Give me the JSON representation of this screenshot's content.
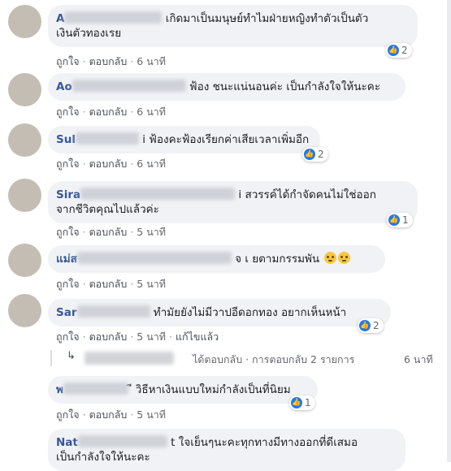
{
  "actions": {
    "like": "ถูกใจ",
    "reply": "ตอบกลับ",
    "edited": "แก้ไขแล้ว"
  },
  "comments": [
    {
      "name": "A",
      "text1": "เกิดมาเป็นมนุษย์ทำไมฝ่ายหญิงทำตัวเป็นตัว",
      "text2": "เงินตัวทองเรย",
      "time": "6 นาที",
      "reactions": "2"
    },
    {
      "name": "Ao",
      "text1": "ฟ้อง ชนะแน่นอนค่ะ เป็นกำลังใจให้นะคะ",
      "time": "6 นาที"
    },
    {
      "name": "Sul",
      "text1": "i ฟ้องคะฟ้องเรียกค่าเสียเวลาเพิ่มอีก",
      "time": "6 นาที",
      "reactions": "2"
    },
    {
      "name": "Sira",
      "text1": "i สวรรค์ได้กำจัดคนไม่ใช่ออก",
      "text2": "จากชีวิตคุณไปแล้วค่ะ",
      "time": "5 นาที",
      "reactions": "1"
    },
    {
      "name": "แม่ส",
      "text1": "จ เ ยตามกรรมพัน",
      "time": "5 นาที"
    },
    {
      "name": "Sar",
      "text1": "ทำมัยยังไม่มีวาปอีดอกทอง อยากเห็นหน้า",
      "time": "5 นาที",
      "reactions": "2"
    },
    {
      "name": "พ",
      "text1": "ี วิธีหาเงินแบบใหม่กำลังเป็นที่นิยม",
      "time": "5 นาที",
      "reactions": "1"
    },
    {
      "name": "Nat",
      "text1": "t ใจเย็นๆนะคะทุกทางมีทางออกที่ดีเสมอ",
      "text2": "เป็นกำลังใจให้นะคะ"
    }
  ],
  "reply_summary": {
    "text": "ได้ตอบกลับ · การตอบกลับ 2 รายการ",
    "time": "6 นาที"
  },
  "colors": {
    "name": "#385898",
    "bubble": "#f0f2f5",
    "like": "#2078f4",
    "meta": "#65676b"
  },
  "icons": {
    "like": "thumbs-up-icon",
    "emoji": "rolling-eyes-emoji-icon",
    "reply": "reply-arrow-icon"
  }
}
